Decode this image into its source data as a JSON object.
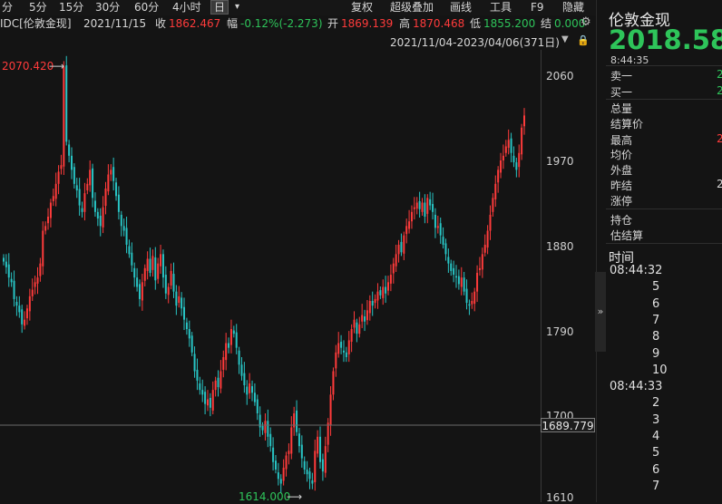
{
  "toolbar": {
    "periods": [
      "分",
      "5分",
      "15分",
      "30分",
      "60分",
      "4小时",
      "日"
    ],
    "active_period": "日",
    "dropdown": "▾",
    "tools": [
      "复权",
      "超级叠加",
      "画线",
      "工具",
      "F9",
      "隐藏"
    ]
  },
  "info": {
    "symbol": "IDC[伦敦金现]",
    "date": "2021/11/15",
    "close_label": "收",
    "close": "1862.467",
    "change_label": "幅",
    "change": "-0.12%(-2.273)",
    "open_label": "开",
    "open": "1869.139",
    "high_label": "高",
    "high": "1870.468",
    "low_label": "低",
    "low": "1855.200",
    "settle_label": "结",
    "settle": "0.000"
  },
  "range_text": "2021/11/04-2023/04/06(371日)",
  "axis": {
    "ticks": [
      "2060",
      "1970",
      "1880",
      "1790",
      "1700",
      "1610"
    ],
    "current_price": "1689.779",
    "high_marker": "2070.420",
    "low_marker": "1614.000"
  },
  "panel": {
    "title": "伦敦金现",
    "price": "2018.580",
    "time": "8:44:35",
    "rows": [
      "卖一",
      "买一",
      "总量",
      "结算价",
      "最高",
      "均价",
      "外盘",
      "昨结",
      "涨停",
      "持仓",
      "估结算"
    ],
    "values": [
      "2",
      "2",
      "",
      "",
      "2",
      "",
      "",
      "2",
      "",
      "",
      ""
    ],
    "ticks_header": "时间",
    "tick_times": [
      "08:44:32",
      "5",
      "6",
      "7",
      "8",
      "9",
      "10",
      "08:44:33",
      "2",
      "3",
      "4",
      "5",
      "6",
      "7"
    ]
  },
  "colors": {
    "up": "#ff3b3b",
    "down": "#28c4c4",
    "accent_green": "#2ec45a"
  },
  "chart_data": {
    "type": "candlestick",
    "x_range": [
      "2021/11/04",
      "2023/04/06"
    ],
    "ylim": [
      1610,
      2060
    ],
    "closes": [
      1862,
      1856,
      1845,
      1840,
      1822,
      1815,
      1808,
      1795,
      1800,
      1812,
      1825,
      1832,
      1840,
      1845,
      1860,
      1895,
      1900,
      1910,
      1925,
      1932,
      1945,
      1958,
      1965,
      2070,
      1990,
      1975,
      1960,
      1945,
      1938,
      1922,
      1915,
      1935,
      1945,
      1960,
      1930,
      1915,
      1908,
      1900,
      1920,
      1940,
      1955,
      1960,
      1948,
      1932,
      1915,
      1900,
      1895,
      1880,
      1870,
      1858,
      1845,
      1835,
      1822,
      1840,
      1855,
      1865,
      1850,
      1868,
      1842,
      1860,
      1870,
      1845,
      1828,
      1835,
      1852,
      1830,
      1815,
      1825,
      1812,
      1800,
      1790,
      1780,
      1765,
      1745,
      1735,
      1725,
      1720,
      1710,
      1715,
      1706,
      1725,
      1735,
      1728,
      1745,
      1760,
      1775,
      1770,
      1790,
      1785,
      1770,
      1752,
      1740,
      1730,
      1720,
      1732,
      1722,
      1712,
      1700,
      1685,
      1682,
      1692,
      1675,
      1665,
      1648,
      1640,
      1630,
      1625,
      1642,
      1655,
      1660,
      1685,
      1700,
      1680,
      1665,
      1652,
      1640,
      1635,
      1630,
      1625,
      1660,
      1675,
      1648,
      1638,
      1665,
      1690,
      1720,
      1745,
      1765,
      1775,
      1770,
      1765,
      1760,
      1778,
      1790,
      1800,
      1785,
      1795,
      1805,
      1798,
      1810,
      1820,
      1815,
      1822,
      1830,
      1826,
      1835,
      1828,
      1840,
      1848,
      1860,
      1870,
      1880,
      1872,
      1890,
      1900,
      1905,
      1915,
      1920,
      1925,
      1918,
      1925,
      1910,
      1930,
      1922,
      1915,
      1898,
      1900,
      1890,
      1880,
      1870,
      1860,
      1852,
      1848,
      1845,
      1838,
      1845,
      1830,
      1818,
      1815,
      1820,
      1830,
      1850,
      1855,
      1870,
      1880,
      1895,
      1912,
      1930,
      1945,
      1960,
      1970,
      1975,
      1985,
      1992,
      1978,
      1968,
      1960,
      1978,
      2005,
      2018
    ]
  }
}
